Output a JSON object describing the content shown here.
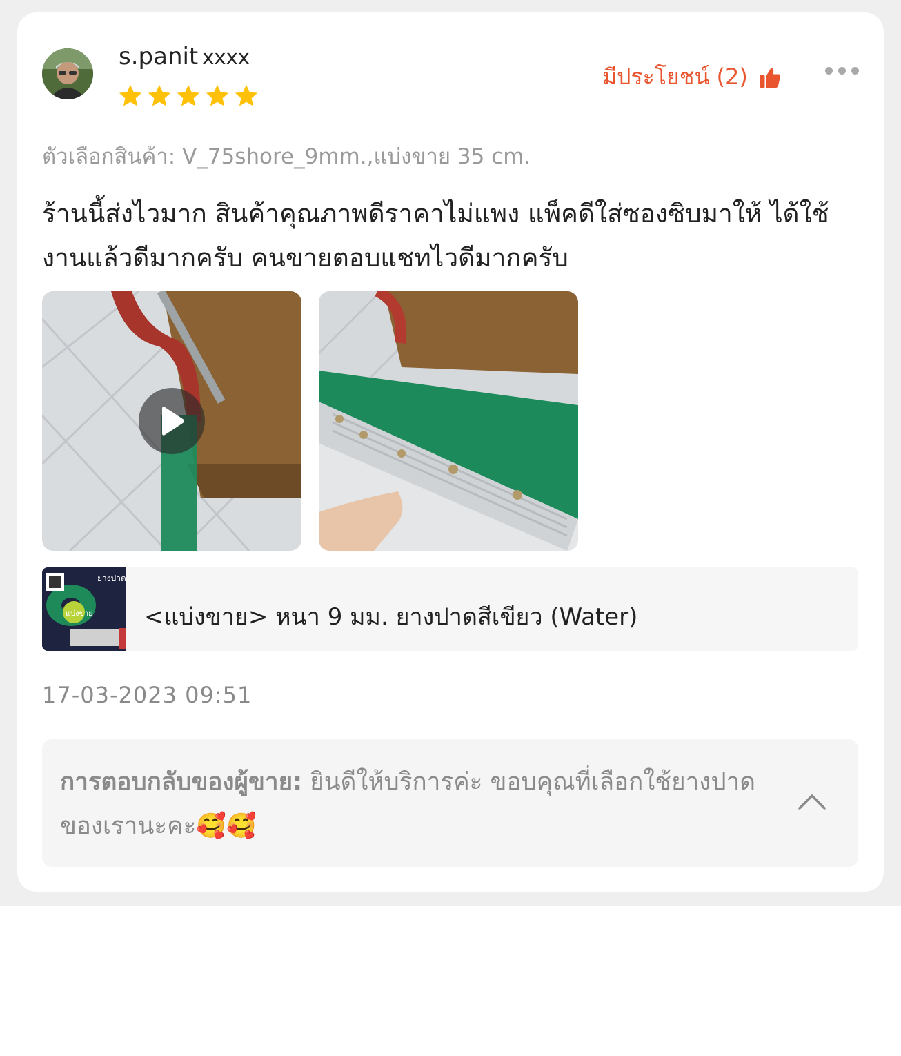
{
  "reviewer": {
    "name": "s.panit",
    "masked_suffix": "xxxx",
    "rating": 5,
    "avatar_icon": "user-avatar-photo"
  },
  "helpful": {
    "label": "มีประโยชน์ (2)",
    "icon": "thumbs-up-icon"
  },
  "more_icon": "more-dots-icon",
  "variation": "ตัวเลือกสินค้า: V_75shore_9mm.,แบ่งขาย 35 cm.",
  "review_text": "ร้านนี้ส่งไวมาก สินค้าคุณภาพดีราคาไม่แพง  แพ็คดีใส่ซองซิบมาให้ ได้ใช้งานแล้วดีมากครับ  คนขายตอบแชทไวดีมากครับ",
  "media": [
    {
      "kind": "video",
      "icon": "play-icon"
    },
    {
      "kind": "image"
    }
  ],
  "product": {
    "name": "<แบ่งขาย> หนา 9 มม. ยางปาดสีเขียว (Water)",
    "thumb_text_1": "ยางปาด",
    "thumb_text_2": "แบ่งขาย"
  },
  "timestamp": "17-03-2023 09:51",
  "seller_reply": {
    "label": "การตอบกลับของผู้ขาย:",
    "text": " ยินดีให้บริการค่ะ ขอบคุณที่เลือกใช้ยางปาดของเรานะคะ🥰🥰",
    "collapse_icon": "chevron-up-icon"
  },
  "colors": {
    "accent": "#e8552f",
    "star": "#ffc107",
    "background": "#efefef"
  }
}
